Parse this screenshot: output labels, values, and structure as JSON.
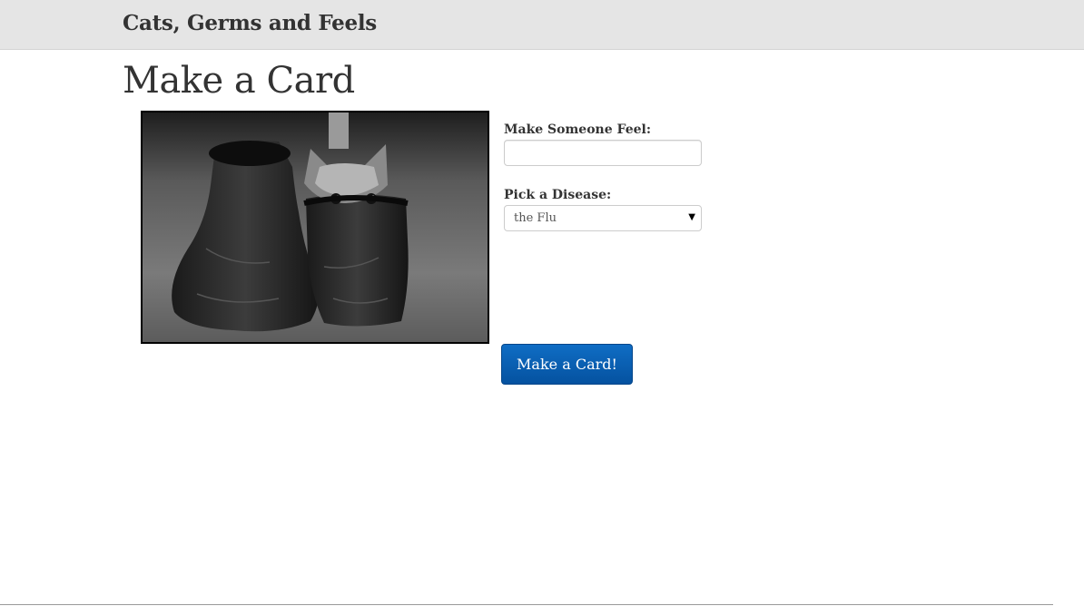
{
  "navbar": {
    "brand": "Cats, Germs and Feels"
  },
  "main": {
    "title": "Make a Card",
    "image": {
      "description_icon": "kitten-in-boot-photo"
    },
    "form": {
      "feel_label": "Make Someone Feel:",
      "feel_value": "",
      "feel_placeholder": "",
      "disease_label": "Pick a Disease:",
      "disease_selected": "the Flu",
      "submit_label": "Make a Card!"
    }
  },
  "colors": {
    "navbar_bg": "#e5e5e5",
    "button_bg": "#0b63b5",
    "text": "#333333"
  }
}
